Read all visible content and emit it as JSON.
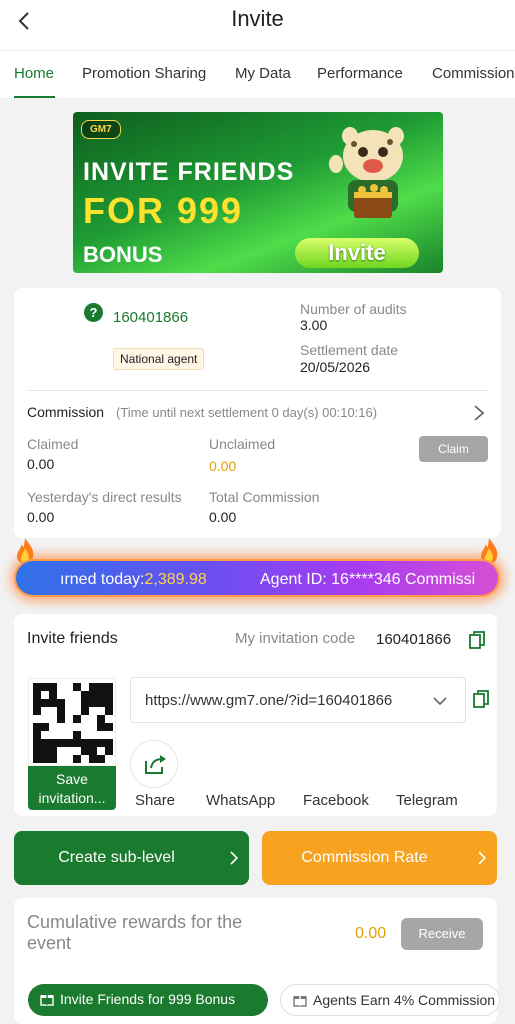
{
  "header": {
    "title": "Invite"
  },
  "tabs": [
    {
      "label": "Home",
      "active": true
    },
    {
      "label": "Promotion Sharing",
      "active": false
    },
    {
      "label": "My Data",
      "active": false
    },
    {
      "label": "Performance",
      "active": false
    },
    {
      "label": "Commission",
      "active": false
    }
  ],
  "banner": {
    "logo": "GM7",
    "line1": "INVITE FRIENDS",
    "line2": "FOR 999",
    "line3": "BONUS",
    "button_label": "Invite"
  },
  "agent_card": {
    "agent_id": "160401866",
    "badge": "National agent",
    "audits_label": "Number of audits",
    "audits_value": "3.00",
    "settlement_label": "Settlement date",
    "settlement_value": "20/05/2026",
    "commission_title": "Commission",
    "commission_subtitle": "(Time until next settlement 0 day(s) 00:10:16)",
    "claimed_label": "Claimed",
    "claimed_value": "0.00",
    "unclaimed_label": "Unclaimed",
    "unclaimed_value": "0.00",
    "claim_button": "Claim",
    "yesterday_label": "Yesterday's direct results",
    "yesterday_value": "0.00",
    "total_label": "Total Commission",
    "total_value": "0.00"
  },
  "ticker": {
    "earned_prefix": "ırned today:",
    "earned_amount": "2,389.98",
    "agent_text": "Agent ID: 16****346 Commissi"
  },
  "invite": {
    "title": "Invite friends",
    "code_label": "My invitation code",
    "code_value": "160401866",
    "link": "https://www.gm7.one/?id=160401866",
    "save_button": "Save invitation...",
    "share_options": [
      "Share",
      "WhatsApp",
      "Facebook",
      "Telegram"
    ]
  },
  "actions": {
    "create_sub_level": "Create sub-level",
    "commission_rate": "Commission Rate"
  },
  "rewards": {
    "title": "Cumulative rewards for the event",
    "value": "0.00",
    "receive_button": "Receive",
    "pills": [
      "Invite Friends for 999 Bonus",
      "Agents Earn 4% Commission"
    ]
  },
  "colors": {
    "brand_green": "#1a7a2e",
    "accent_orange": "#f7a320",
    "gold": "#e1a400",
    "disabled_gray": "#a6a6a6"
  }
}
